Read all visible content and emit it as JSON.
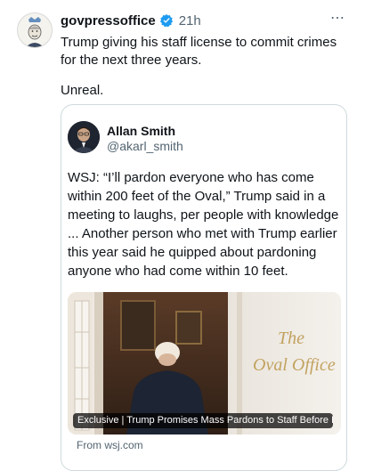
{
  "post": {
    "author": "govpressoffice",
    "verified": true,
    "timestamp": "21h",
    "more_icon": "⋯",
    "text_line1": "Trump giving his staff license to commit crimes for the next three years.",
    "text_line2": "Unreal."
  },
  "quote": {
    "name": "Allan Smith",
    "handle": "@akarl_smith",
    "text": "WSJ: “I’ll pardon everyone who has come within 200 feet of the Oval,” Trump said in a meeting to laughs, per people with knowledge ... Another person who met with Trump earlier this year said he quipped about pardoning anyone who had come within 10 feet.",
    "link_card": {
      "caption": "Exclusive | Trump Promises Mass Pardons to Staff Before L...",
      "source": "From wsj.com",
      "image_text": "The Oval Office"
    }
  },
  "colors": {
    "verified": "#1d9bf0",
    "secondary_text": "#536471",
    "border": "#cfd9de"
  },
  "icons": [
    "more-icon",
    "verified-badge-icon"
  ]
}
